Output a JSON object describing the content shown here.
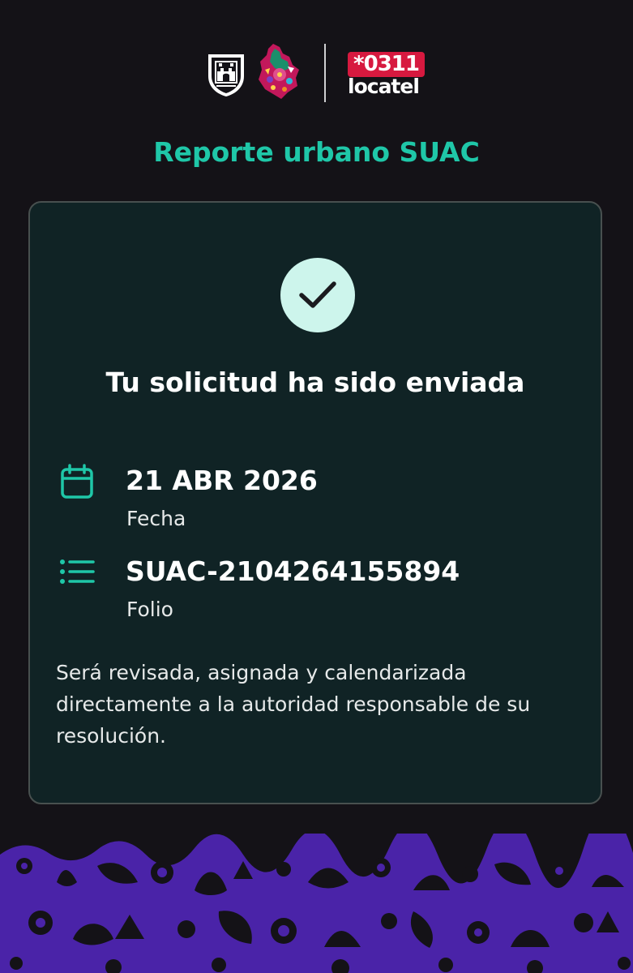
{
  "header": {
    "logo_badge_text": "*0311",
    "logo_word": "locatel"
  },
  "page": {
    "title": "Reporte urbano SUAC"
  },
  "card": {
    "heading": "Tu solicitud ha sido enviada",
    "date": {
      "value": "21 ABR 2026",
      "label": "Fecha",
      "icon": "calendar-icon"
    },
    "folio": {
      "value": "SUAC-2104264155894",
      "label": "Folio",
      "icon": "list-icon"
    },
    "note": "Será revisada, asignada y calendarizada directamente a la autoridad responsable de su resolución."
  },
  "colors": {
    "background": "#141217",
    "accent": "#1fc7a8",
    "card_background": "#102325",
    "check_circle": "#cdf5ec",
    "locatel_red": "#d7193f",
    "footer_purple": "#4a23a8"
  }
}
